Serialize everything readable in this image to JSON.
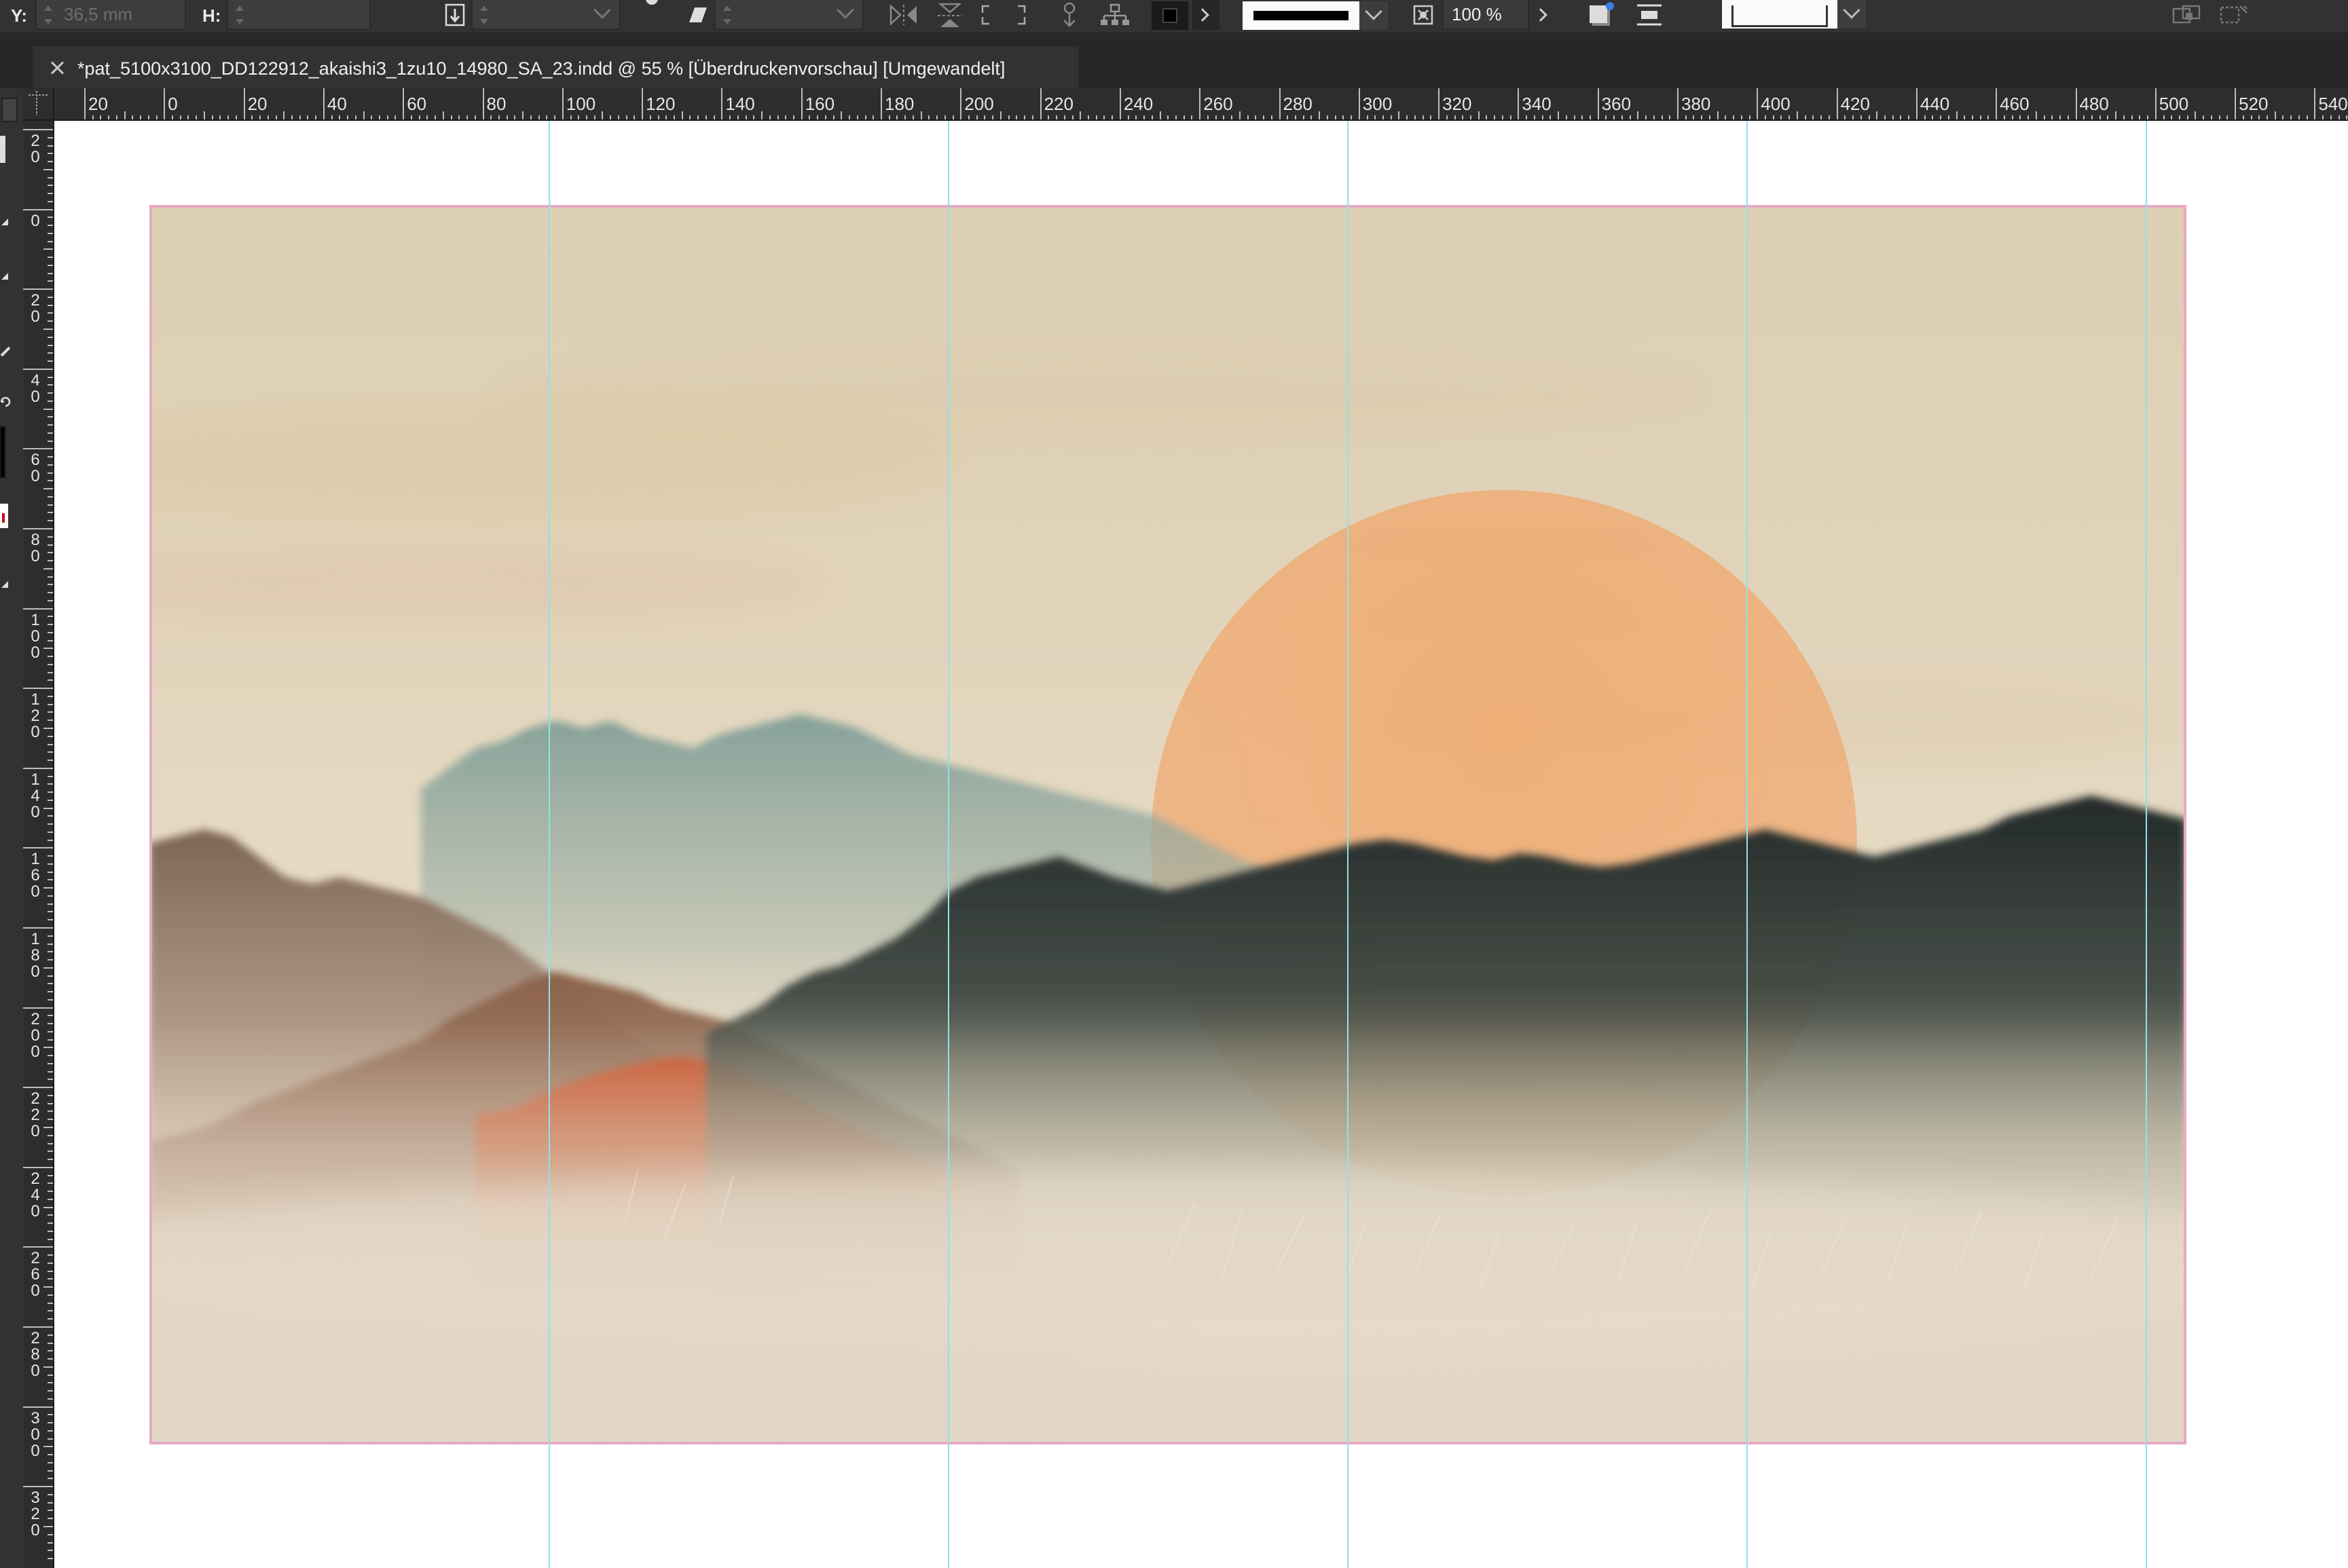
{
  "control_bar": {
    "y_label": "Y:",
    "y_value": "36,5 mm",
    "h_label": "H:",
    "h_value": "",
    "opacity_value": "100 %",
    "icons": [
      "reference-point-icon",
      "shear-icon",
      "flip-horizontal-icon",
      "flip-vertical-icon",
      "select-container-icon",
      "select-content-icon",
      "hierarchy-icon",
      "fill-swatch-icon",
      "stroke-weight-icon",
      "opacity-icon",
      "drop-shadow-icon",
      "text-wrap-icon",
      "frame-fitting-icon"
    ]
  },
  "document": {
    "tab_title": "*pat_5100x3100_DD122912_akaishi3_1zu10_14980_SA_23.indd @ 55 % [Überdruckenvorschau] [Umgewandelt]"
  },
  "rulers": {
    "horizontal_labels": [
      "20",
      "0",
      "20",
      "40",
      "60",
      "80",
      "100",
      "120",
      "140",
      "160",
      "180",
      "200",
      "220",
      "240",
      "260",
      "280",
      "300",
      "320",
      "340",
      "360",
      "380",
      "400",
      "420",
      "440",
      "460",
      "480",
      "500",
      "520",
      "540"
    ],
    "vertical_labels": [
      "20",
      "0",
      "20",
      "40",
      "60",
      "80",
      "100",
      "120",
      "140",
      "160",
      "180",
      "200",
      "220",
      "240",
      "260",
      "280",
      "300",
      "320"
    ]
  },
  "colors": {
    "paper": "#e4d6bd",
    "sun": "#efa86b",
    "teal_hills": "#8aa59d",
    "dark_ridge": "#2d3433",
    "brown_hills": "#8a6a55",
    "rust_hill": "#c4532c",
    "page_border": "#e6a9c6",
    "guide": "#8ee3e6"
  }
}
